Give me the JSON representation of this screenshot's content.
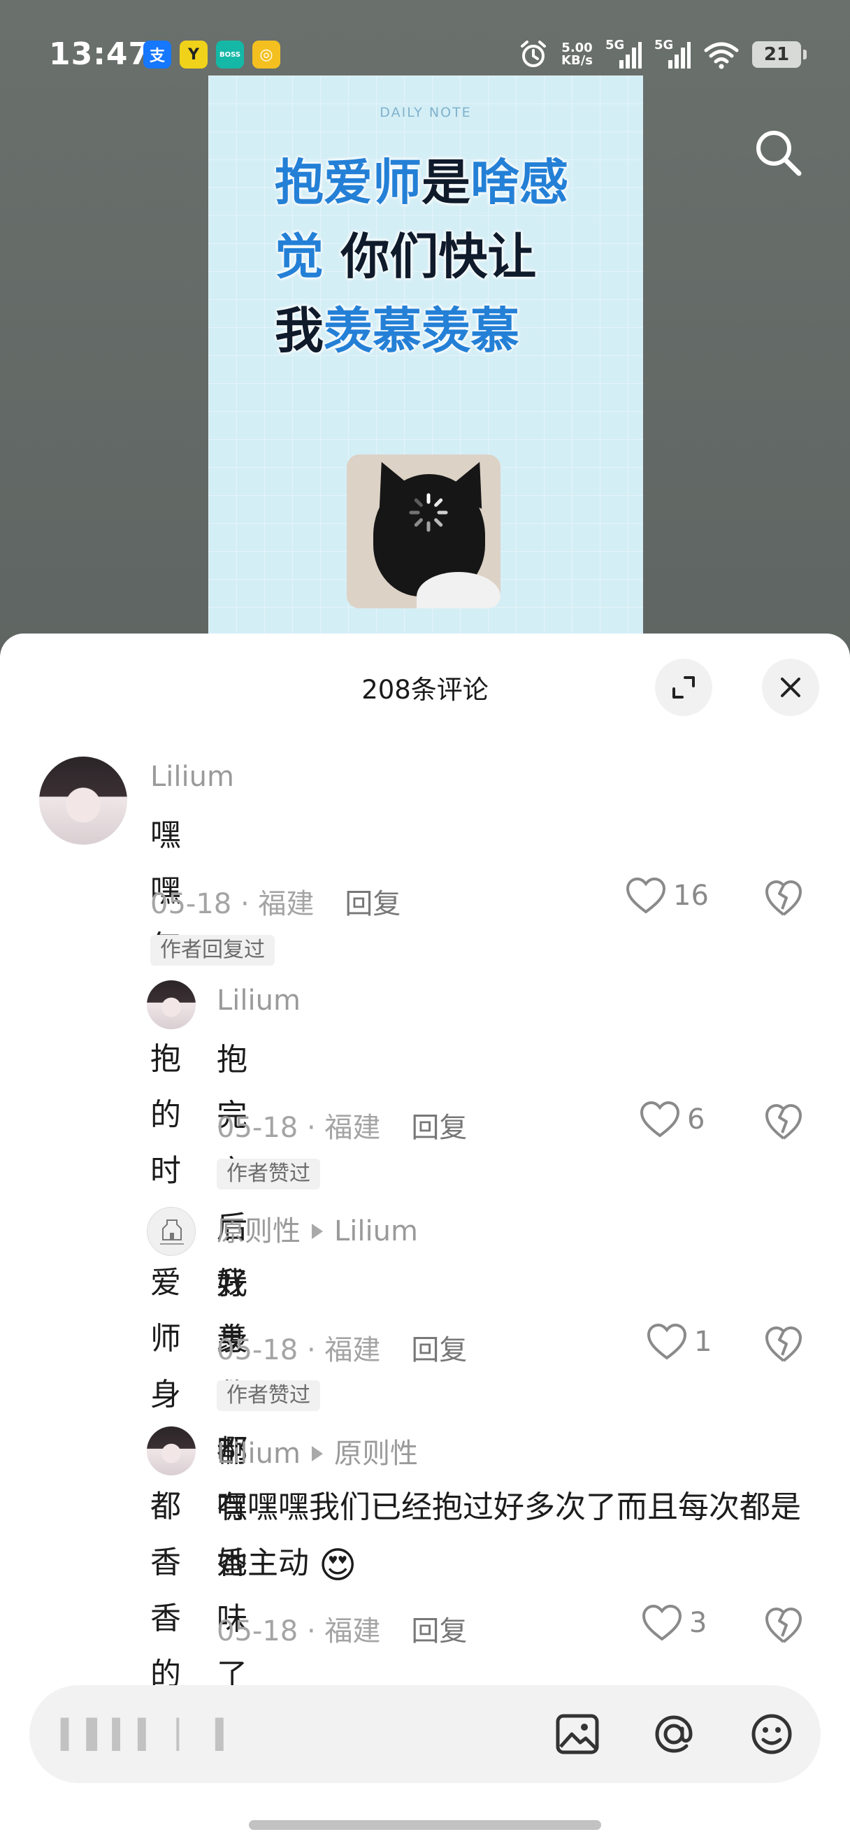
{
  "status_bar": {
    "time": "13:47",
    "apps": [
      {
        "icon": "alipay-icon",
        "glyph": "支",
        "color": "#1677ff"
      },
      {
        "icon": "app-y-icon",
        "glyph": "Y",
        "color": "#f1d21a"
      },
      {
        "icon": "boss-zhipin-icon",
        "glyph": "BOSS",
        "color": "#15b8a6"
      },
      {
        "icon": "gold-app-icon",
        "glyph": "◎",
        "color": "#f3c020"
      }
    ],
    "net_speed": "5.00",
    "net_unit": "KB/s",
    "signal_label_1": "5G",
    "signal_label_2": "5G",
    "battery": "21"
  },
  "post": {
    "label": "DAILY NOTE",
    "title_parts": [
      {
        "text": "抱爱师",
        "blue": true
      },
      {
        "text": "是",
        "blue": false
      },
      {
        "text": "啥感觉",
        "blue": true
      },
      {
        "text": " 你们快让我",
        "blue": false
      },
      {
        "text": "羡慕羡慕",
        "blue": true
      }
    ]
  },
  "sheet": {
    "title": "208条评论"
  },
  "comments": [
    {
      "name": "Lilium",
      "reply_to": "",
      "text": "嘿嘿每次抱的时候爱师身上都香香的",
      "emoji": "😍",
      "date": "05-18",
      "location": "福建",
      "reply_label": "回复",
      "likes": "16",
      "tag": "作者回复过"
    },
    {
      "name": "Lilium",
      "reply_to": "",
      "text": "抱完之后我身上都有香味了",
      "emoji": "🥺",
      "date": "05-18",
      "location": "福建",
      "reply_label": "回复",
      "likes": "6",
      "tag": "作者赞过"
    },
    {
      "name": "原则性",
      "reply_to": "Lilium",
      "text": "好羡慕啊",
      "emoji": "",
      "date": "05-18",
      "location": "福建",
      "reply_label": "回复",
      "likes": "1",
      "tag": "作者赞过"
    },
    {
      "name": "Lilium",
      "reply_to": "原则性",
      "text": "嘿嘿嘿我们已经抱过好多次了而且每次都是她主动",
      "emoji": "😍",
      "date": "05-18",
      "location": "福建",
      "reply_label": "回复",
      "likes": "3",
      "tag": ""
    }
  ],
  "input": {
    "placeholder": "▍▌▍▍  ▏ ▍"
  },
  "colors": {
    "accent_blue": "#2480d6",
    "sheet_bg": "#ffffff",
    "muted_text": "#9a9a9a"
  }
}
